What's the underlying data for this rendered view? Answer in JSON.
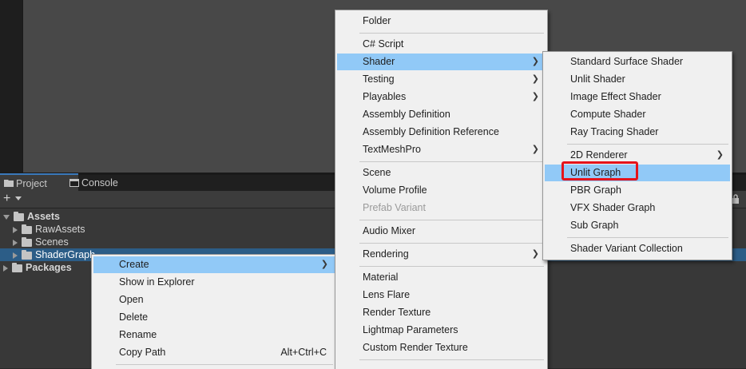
{
  "tabs": {
    "project": "Project",
    "console": "Console"
  },
  "toolbar": {
    "plus": "+"
  },
  "tree": {
    "assets": "Assets",
    "raw_assets": "RawAssets",
    "scenes": "Scenes",
    "shader_graph": "ShaderGraph",
    "packages": "Packages"
  },
  "context_menu": {
    "create": "Create",
    "show_in_explorer": "Show in Explorer",
    "open": "Open",
    "delete": "Delete",
    "rename": "Rename",
    "copy_path": "Copy Path",
    "copy_path_shortcut": "Alt+Ctrl+C"
  },
  "create_menu": {
    "folder": "Folder",
    "csharp_script": "C# Script",
    "shader": "Shader",
    "testing": "Testing",
    "playables": "Playables",
    "assembly_definition": "Assembly Definition",
    "assembly_definition_reference": "Assembly Definition Reference",
    "textmeshpro": "TextMeshPro",
    "scene": "Scene",
    "volume_profile": "Volume Profile",
    "prefab_variant": "Prefab Variant",
    "audio_mixer": "Audio Mixer",
    "rendering": "Rendering",
    "material": "Material",
    "lens_flare": "Lens Flare",
    "render_texture": "Render Texture",
    "lightmap_parameters": "Lightmap Parameters",
    "custom_render_texture": "Custom Render Texture"
  },
  "shader_menu": {
    "standard_surface_shader": "Standard Surface Shader",
    "unlit_shader": "Unlit Shader",
    "image_effect_shader": "Image Effect Shader",
    "compute_shader": "Compute Shader",
    "ray_tracing_shader": "Ray Tracing Shader",
    "renderer_2d": "2D Renderer",
    "unlit_graph": "Unlit Graph",
    "pbr_graph": "PBR Graph",
    "vfx_shader_graph": "VFX Shader Graph",
    "sub_graph": "Sub Graph",
    "shader_variant_collection": "Shader Variant Collection"
  },
  "colors": {
    "menu_bg": "#f0f0f0",
    "menu_highlight": "#91c9f7",
    "selection": "#2c5d87",
    "annotation": "#e5141b"
  },
  "icons": {
    "project_tab": "folder-icon",
    "console_tab": "console-icon",
    "submenu": "chevron-right-icon"
  }
}
